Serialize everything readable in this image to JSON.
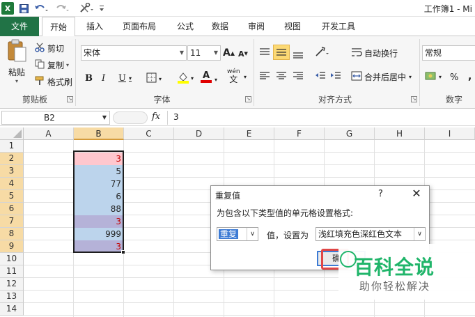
{
  "titlebar": {
    "app_logo": "X",
    "title": "工作簿1 - Mi",
    "icons": [
      "excel-logo-icon",
      "save-icon",
      "undo-icon",
      "redo-icon",
      "tools-icon",
      "customize-icon"
    ]
  },
  "tabs": [
    "文件",
    "开始",
    "插入",
    "页面布局",
    "公式",
    "数据",
    "审阅",
    "视图",
    "开发工具"
  ],
  "ribbon": {
    "clipboard": {
      "paste": "粘贴",
      "cut": "剪切",
      "copy": "复制",
      "format_painter": "格式刷",
      "label": "剪贴板"
    },
    "font": {
      "name": "宋体",
      "size": "11",
      "bold": "B",
      "italic": "I",
      "underline": "U",
      "label": "字体",
      "grow": "A",
      "shrink": "A",
      "font_color": "A",
      "wen": "wén",
      "wen_char": "文"
    },
    "alignment": {
      "wrap": "自动换行",
      "merge": "合并后居中",
      "label": "对齐方式"
    },
    "number": {
      "format": "常规",
      "percent": "%",
      "comma": ",",
      "label": "数字"
    }
  },
  "formula_bar": {
    "name_box": "B2",
    "fx": "fx",
    "value": "3"
  },
  "sheet": {
    "columns": [
      "A",
      "B",
      "C",
      "D",
      "E",
      "F",
      "G",
      "H",
      "I"
    ],
    "rows": [
      "1",
      "2",
      "3",
      "4",
      "5",
      "6",
      "7",
      "8",
      "9",
      "10",
      "11",
      "12",
      "13",
      "14"
    ],
    "selected_column": "B",
    "column_b": [
      {
        "row": "2",
        "value": "3",
        "fill": "#ffc7ce",
        "color": "#c00000"
      },
      {
        "row": "3",
        "value": "5",
        "fill": "#bcd4ec",
        "color": "#222222"
      },
      {
        "row": "4",
        "value": "77",
        "fill": "#bcd4ec",
        "color": "#222222"
      },
      {
        "row": "5",
        "value": "6",
        "fill": "#bcd4ec",
        "color": "#222222"
      },
      {
        "row": "6",
        "value": "88",
        "fill": "#bcd4ec",
        "color": "#222222"
      },
      {
        "row": "7",
        "value": "3",
        "fill": "#b5b2d8",
        "color": "#c00000"
      },
      {
        "row": "8",
        "value": "999",
        "fill": "#bcd4ec",
        "color": "#222222"
      },
      {
        "row": "9",
        "value": "3",
        "fill": "#b5b2d8",
        "color": "#c00000"
      }
    ]
  },
  "dialog": {
    "title": "重复值",
    "help": "?",
    "close": "✕",
    "prompt": "为包含以下类型值的单元格设置格式:",
    "rule_value": "重复",
    "middle_text": "值，设置为",
    "format_value": "浅红填充色深红色文本",
    "ok_label": "确"
  },
  "watermark": {
    "brand": "百科全说",
    "slogan": "助你轻松解决"
  }
}
